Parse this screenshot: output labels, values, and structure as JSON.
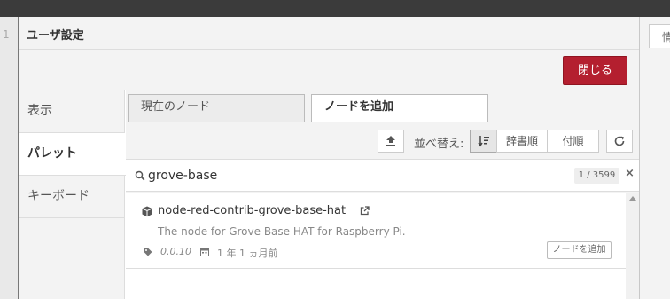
{
  "dialog": {
    "title": "ユーザ設定",
    "close_label": "閉じる"
  },
  "background": {
    "left_tab_number": "1",
    "right_tab_label": "情"
  },
  "nav": {
    "items": [
      {
        "label": "表示",
        "active": false
      },
      {
        "label": "パレット",
        "active": true
      },
      {
        "label": "キーボード",
        "active": false
      }
    ]
  },
  "tabs": {
    "current_nodes": "現在のノード",
    "install_nodes": "ノードを追加"
  },
  "sort": {
    "label": "並べ替え:",
    "alpha_label": "辞書順",
    "date_label": "付順"
  },
  "search": {
    "value": "grove-base",
    "count": "1 / 3599",
    "clear_icon": "×"
  },
  "results": [
    {
      "name": "node-red-contrib-grove-base-hat",
      "description": "The node for Grove Base HAT for Raspberry Pi.",
      "version": "0.0.10",
      "updated": "1 年 1 ヵ月前",
      "add_label": "ノードを追加"
    }
  ],
  "icons": [
    "upload-icon",
    "sort-relevance-icon",
    "refresh-icon",
    "search-icon",
    "package-icon",
    "external-link-icon",
    "tag-icon",
    "calendar-icon"
  ],
  "colors": {
    "primary_button": "#b41f2f",
    "header_bar": "#3b3b3b"
  }
}
